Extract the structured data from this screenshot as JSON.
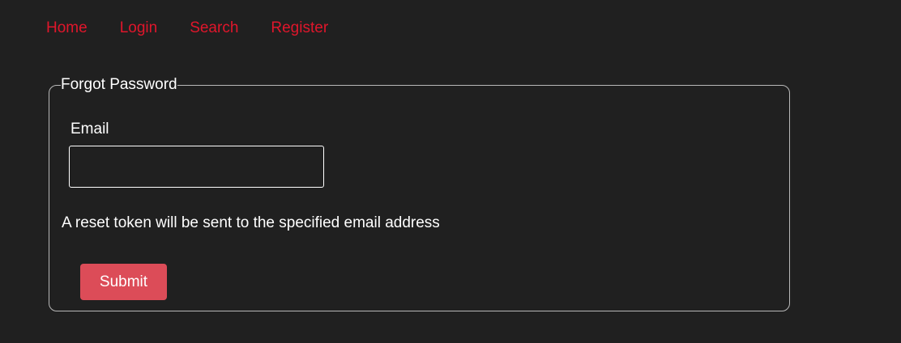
{
  "nav": {
    "items": [
      {
        "label": "Home"
      },
      {
        "label": "Login"
      },
      {
        "label": "Search"
      },
      {
        "label": "Register"
      }
    ],
    "link_color": "#e0162b"
  },
  "form": {
    "legend": "Forgot Password",
    "email_label": "Email",
    "email_value": "",
    "email_placeholder": "",
    "info_text": "A reset token will be sent to the specified email address",
    "submit_label": "Submit",
    "submit_color": "#dc4c58"
  },
  "colors": {
    "background": "#202020",
    "text": "#ffffff",
    "border": "#b8b8b8"
  }
}
